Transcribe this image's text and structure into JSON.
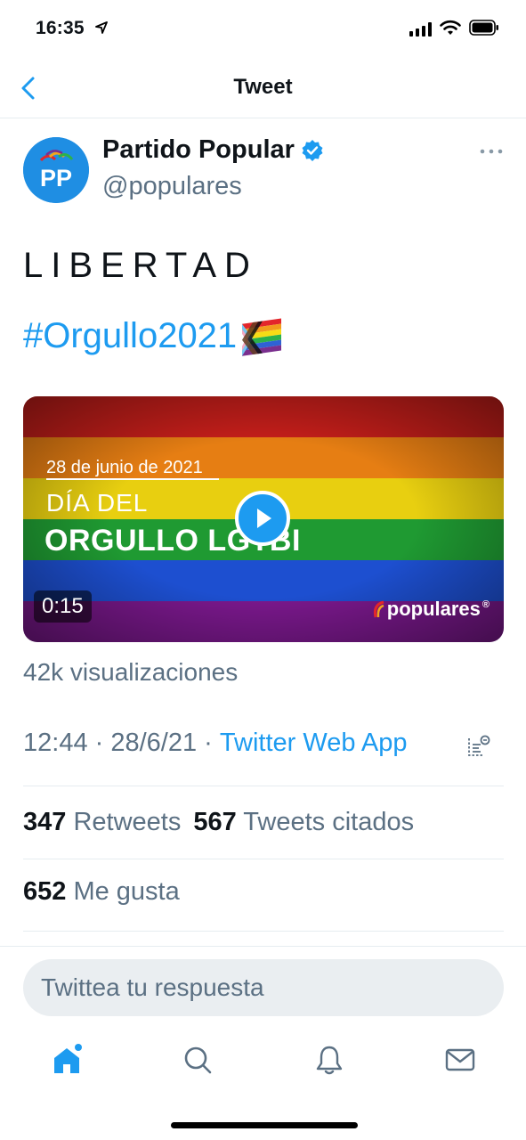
{
  "status_bar": {
    "time": "16:35"
  },
  "nav": {
    "title": "Tweet"
  },
  "author": {
    "name": "Partido Popular",
    "handle": "@populares",
    "avatar_text": "PP"
  },
  "tweet": {
    "text": "LIBERTAD",
    "hashtag": "#Orgullo2021",
    "video": {
      "date_text": "28 de junio de 2021",
      "line1": "DÍA DEL",
      "line2": "ORGULLO LGTBI",
      "duration": "0:15",
      "logo_text": "populares",
      "logo_mark": "®"
    },
    "views": "42k visualizaciones",
    "time": "12:44",
    "date": "28/6/21",
    "separator": " · ",
    "source": "Twitter Web App"
  },
  "stats": {
    "retweets_count": "347",
    "retweets_label": "Retweets",
    "quotes_count": "567",
    "quotes_label": "Tweets citados",
    "likes_count": "652",
    "likes_label": "Me gusta"
  },
  "reply": {
    "placeholder": "Twittea tu respuesta"
  },
  "icons": {
    "back": "chevron-left-icon",
    "verified": "verified-badge-icon",
    "more": "more-icon",
    "play": "play-icon",
    "analytics": "analytics-icon",
    "tabs": [
      "home-icon",
      "search-icon",
      "notifications-icon",
      "messages-icon"
    ]
  },
  "colors": {
    "accent": "#1d9bf0",
    "secondary_text": "#5b7083",
    "primary_text": "#0f1419",
    "reply_bg": "#eaeef1",
    "divider": "#e6ecf0",
    "pride_flag": [
      "#d1231e",
      "#ee7d16",
      "#efd10f",
      "#229a33",
      "#1f55d0",
      "#7a1e8e"
    ]
  }
}
